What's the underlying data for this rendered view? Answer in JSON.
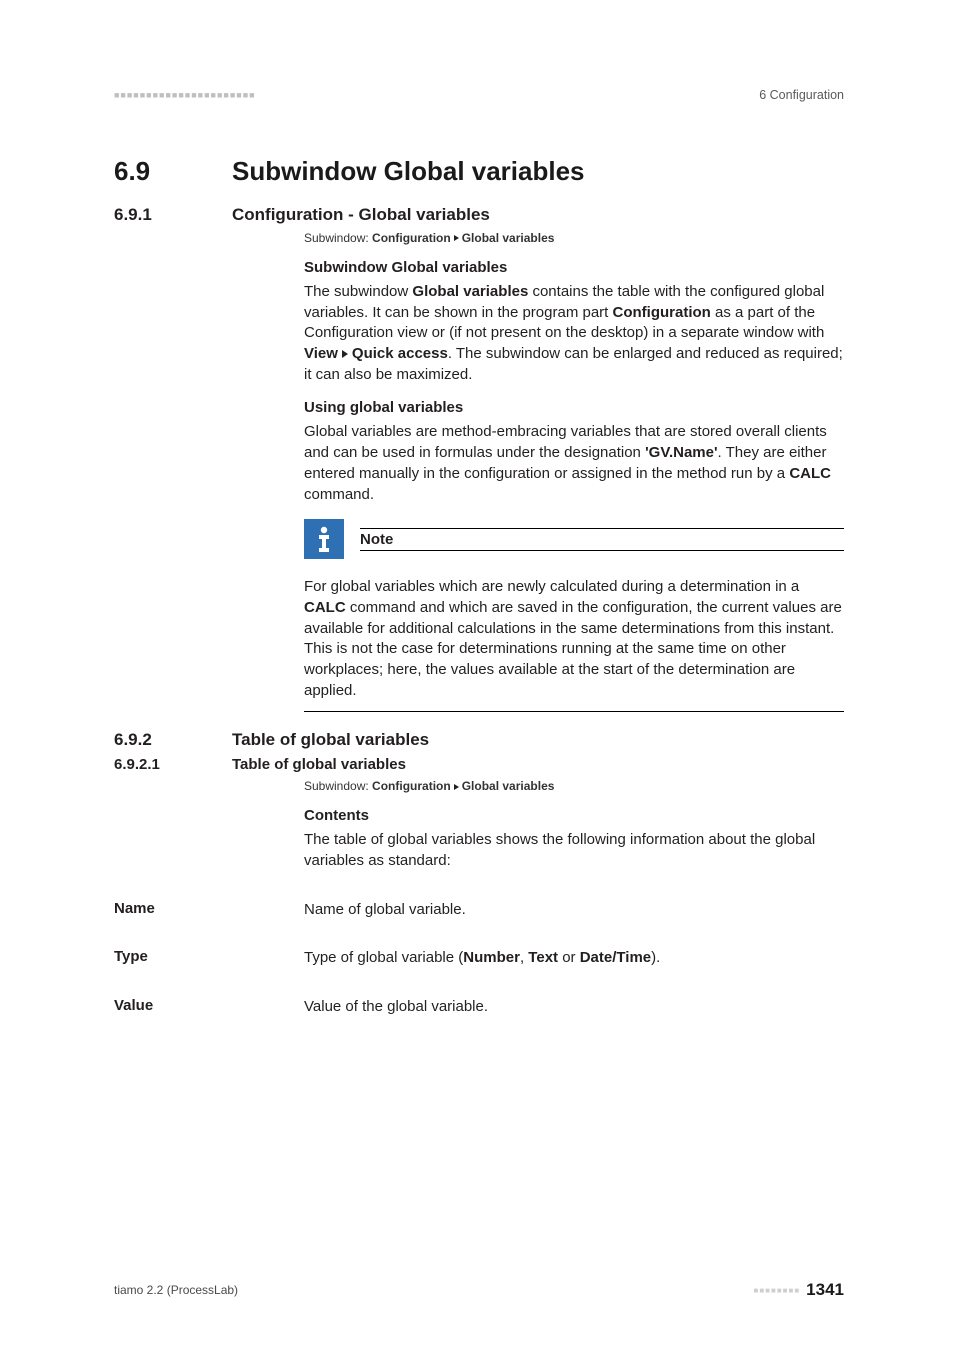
{
  "header": {
    "chapter": "6 Configuration"
  },
  "s69": {
    "num": "6.9",
    "title": "Subwindow Global variables"
  },
  "s691": {
    "num": "6.9.1",
    "title": "Configuration - Global variables",
    "path_prefix": "Subwindow: ",
    "path_a": "Configuration",
    "path_b": "Global variables",
    "sub1": "Subwindow Global variables",
    "p1a": "The subwindow ",
    "p1b": "Global variables",
    "p1c": " contains the table with the configured global variables. It can be shown in the program part ",
    "p1d": "Configuration",
    "p1e": " as a part of the Configuration view or (if not present on the desktop) in a separate window with ",
    "p1f": "View",
    "p1g": "Quick access",
    "p1h": ". The subwindow can be enlarged and reduced as required; it can also be maximized.",
    "sub2": "Using global variables",
    "p2a": "Global variables are method-embracing variables that are stored overall clients and can be used in formulas under the designation ",
    "p2b": "'GV.Name'",
    "p2c": ". They are either entered manually in the configuration or assigned in the method run by a ",
    "p2d": "CALC",
    "p2e": " command.",
    "note_label": "Note",
    "note_a": "For global variables which are newly calculated during a determination in a ",
    "note_b": "CALC",
    "note_c": " command and which are saved in the configuration, the current values are available for additional calculations in the same determinations from this instant. This is not the case for determinations running at the same time on other workplaces; here, the values available at the start of the determination are applied."
  },
  "s692": {
    "num": "6.9.2",
    "title": "Table of global variables"
  },
  "s6921": {
    "num": "6.9.2.1",
    "title": "Table of global variables",
    "path_prefix": "Subwindow: ",
    "path_a": "Configuration",
    "path_b": "Global variables",
    "contents_head": "Contents",
    "contents_p": "The table of global variables shows the following information about the global variables as standard:",
    "f_name": "Name",
    "f_name_d": "Name of global variable.",
    "f_type": "Type",
    "f_type_a": "Type of global variable (",
    "f_type_b": "Number",
    "f_type_c": ", ",
    "f_type_d": "Text",
    "f_type_e": " or ",
    "f_type_f": "Date/Time",
    "f_type_g": ").",
    "f_value": "Value",
    "f_value_d": "Value of the global variable."
  },
  "footer": {
    "left": "tiamo 2.2 (ProcessLab)",
    "page": "1341"
  }
}
